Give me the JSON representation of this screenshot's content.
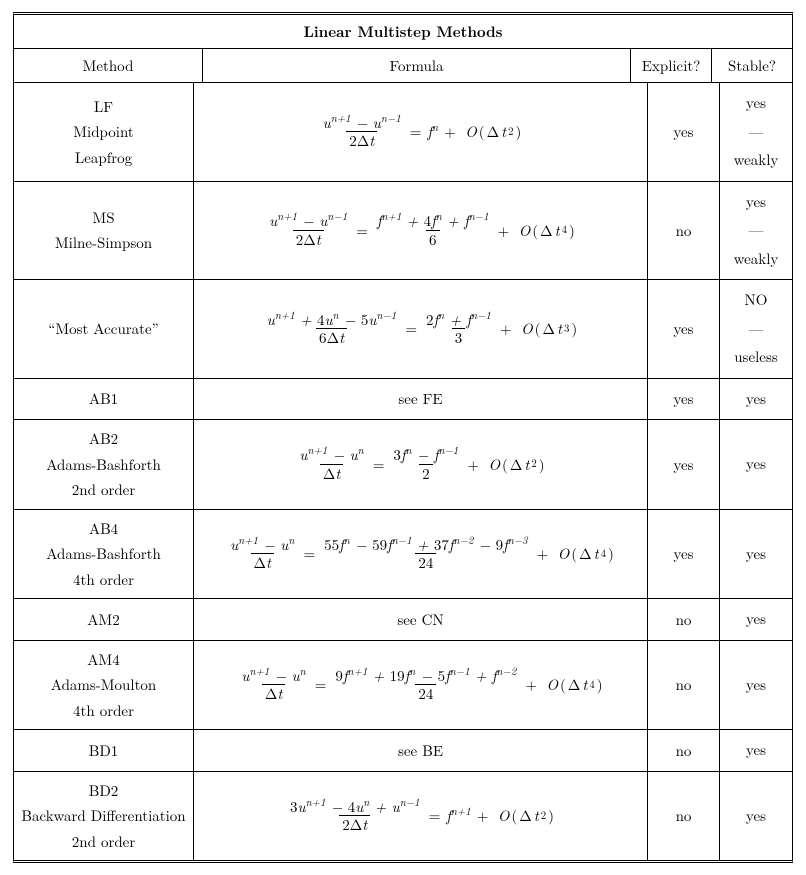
{
  "title": "Linear Multistep Methods",
  "headers": {
    "method": "Method",
    "formula": "Formula",
    "explicit": "Explicit?",
    "stable": "Stable?"
  },
  "rows": [
    {
      "id": "lf",
      "method": [
        "LF",
        "Midpoint",
        "Leapfrog"
      ],
      "lhs": {
        "num": "u^{n+1} - u^{n-1}",
        "den": "2Δt"
      },
      "rhs": {
        "raw": "f^n"
      },
      "order": "O(Δt^2)",
      "explicit": "yes",
      "stable": [
        "yes",
        "—",
        "weakly"
      ]
    },
    {
      "id": "ms",
      "method": [
        "MS",
        "Milne-Simpson"
      ],
      "lhs": {
        "num": "u^{n+1} - u^{n-1}",
        "den": "2Δt"
      },
      "rhs": {
        "num": "f^{n+1} + 4f^n + f^{n-1}",
        "den": "6"
      },
      "order": "O(Δt^4)",
      "explicit": "no",
      "stable": [
        "yes",
        "—",
        "weakly"
      ]
    },
    {
      "id": "mostacc",
      "method": [
        "“Most Accurate”"
      ],
      "lhs": {
        "num": "u^{n+1} + 4u^n - 5u^{n-1}",
        "den": "6Δt"
      },
      "rhs": {
        "num": "2f^n + f^{n-1}",
        "den": "3"
      },
      "order": "O(Δt^3)",
      "explicit": "yes",
      "stable": [
        "NO",
        "—",
        "useless"
      ]
    },
    {
      "id": "ab1",
      "method": [
        "AB1"
      ],
      "formula_plain": "see FE",
      "explicit": "yes",
      "stable": [
        "yes"
      ]
    },
    {
      "id": "ab2",
      "method": [
        "AB2",
        "Adams-Bashforth",
        "2nd order"
      ],
      "lhs": {
        "num": "u^{n+1} - u^n",
        "den": "Δt"
      },
      "rhs": {
        "num": "3f^n - f^{n-1}",
        "den": "2"
      },
      "order": "O(Δt^2)",
      "explicit": "yes",
      "stable": [
        "yes"
      ]
    },
    {
      "id": "ab4",
      "method": [
        "AB4",
        "Adams-Bashforth",
        "4th order"
      ],
      "lhs": {
        "num": "u^{n+1} - u^n",
        "den": "Δt"
      },
      "rhs": {
        "num": "55f^n - 59f^{n-1} + 37f^{n-2} - 9f^{n-3}",
        "den": "24"
      },
      "order": "O(Δt^4)",
      "explicit": "yes",
      "stable": [
        "yes"
      ]
    },
    {
      "id": "am2",
      "method": [
        "AM2"
      ],
      "formula_plain": "see CN",
      "explicit": "no",
      "stable": [
        "yes"
      ]
    },
    {
      "id": "am4",
      "method": [
        "AM4",
        "Adams-Moulton",
        "4th order"
      ],
      "lhs": {
        "num": "u^{n+1} - u^n",
        "den": "Δt"
      },
      "rhs": {
        "num": "9f^{n+1} + 19f^n - 5f^{n-1} + f^{n-2}",
        "den": "24"
      },
      "order": "O(Δt^4)",
      "explicit": "no",
      "stable": [
        "yes"
      ]
    },
    {
      "id": "bd1",
      "method": [
        "BD1"
      ],
      "formula_plain": "see BE",
      "explicit": "no",
      "stable": [
        "yes"
      ]
    },
    {
      "id": "bd2",
      "method": [
        "BD2",
        "Backward Differentiation",
        "2nd order"
      ],
      "lhs": {
        "num": "3u^{n+1} - 4u^n + u^{n-1}",
        "den": "2Δt"
      },
      "rhs": {
        "raw": "f^{n+1}"
      },
      "order": "O(Δt^2)",
      "explicit": "no",
      "stable": [
        "yes"
      ]
    }
  ],
  "chart_data": {
    "type": "table",
    "title": "Linear Multistep Methods",
    "columns": [
      "Method",
      "Formula",
      "Explicit?",
      "Stable?"
    ],
    "rows": [
      [
        "LF / Midpoint / Leapfrog",
        "(u^{n+1}-u^{n-1})/(2Δt) = f^n + O(Δt^2)",
        "yes",
        "yes / — / weakly"
      ],
      [
        "MS / Milne-Simpson",
        "(u^{n+1}-u^{n-1})/(2Δt) = (f^{n+1}+4f^n+f^{n-1})/6 + O(Δt^4)",
        "no",
        "yes / — / weakly"
      ],
      [
        "“Most Accurate”",
        "(u^{n+1}+4u^n-5u^{n-1})/(6Δt) = (2f^n+f^{n-1})/3 + O(Δt^3)",
        "yes",
        "NO / — / useless"
      ],
      [
        "AB1",
        "see FE",
        "yes",
        "yes"
      ],
      [
        "AB2 / Adams-Bashforth 2nd order",
        "(u^{n+1}-u^n)/Δt = (3f^n-f^{n-1})/2 + O(Δt^2)",
        "yes",
        "yes"
      ],
      [
        "AB4 / Adams-Bashforth 4th order",
        "(u^{n+1}-u^n)/Δt = (55f^n-59f^{n-1}+37f^{n-2}-9f^{n-3})/24 + O(Δt^4)",
        "yes",
        "yes"
      ],
      [
        "AM2",
        "see CN",
        "no",
        "yes"
      ],
      [
        "AM4 / Adams-Moulton 4th order",
        "(u^{n+1}-u^n)/Δt = (9f^{n+1}+19f^n-5f^{n-1}+f^{n-2})/24 + O(Δt^4)",
        "no",
        "yes"
      ],
      [
        "BD1",
        "see BE",
        "no",
        "yes"
      ],
      [
        "BD2 / Backward Differentiation 2nd order",
        "(3u^{n+1}-4u^n+u^{n-1})/(2Δt) = f^{n+1} + O(Δt^2)",
        "no",
        "yes"
      ]
    ]
  }
}
